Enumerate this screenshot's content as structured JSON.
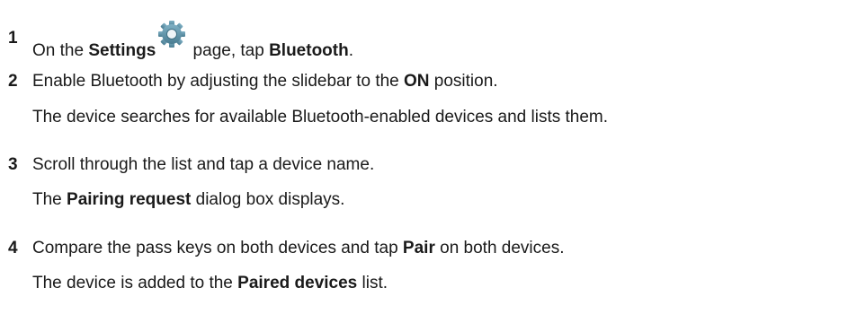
{
  "steps": [
    {
      "number": "1",
      "text": {
        "a": "On the ",
        "b_settings": "Settings",
        "c": " page, tap ",
        "d_bluetooth": "Bluetooth",
        "e": "."
      },
      "icon": "settings-gear-icon"
    },
    {
      "number": "2",
      "text": {
        "a": "Enable Bluetooth by adjusting the slidebar to the ",
        "b_on": "ON",
        "c": " position."
      },
      "result": "The device searches for available Bluetooth-enabled devices and lists them."
    },
    {
      "number": "3",
      "text": "Scroll through the list and tap a device name.",
      "result": {
        "a": "The ",
        "b_pairing": "Pairing request",
        "c": " dialog box displays."
      }
    },
    {
      "number": "4",
      "text": {
        "a": "Compare the pass keys on both devices and tap ",
        "b_pair": "Pair",
        "c": " on both devices."
      },
      "result": {
        "a": "The device is added to the ",
        "b_paired": "Paired devices",
        "c": " list."
      }
    }
  ],
  "colors": {
    "text": "#1a1a1a",
    "icon": "#5f8fa3"
  }
}
